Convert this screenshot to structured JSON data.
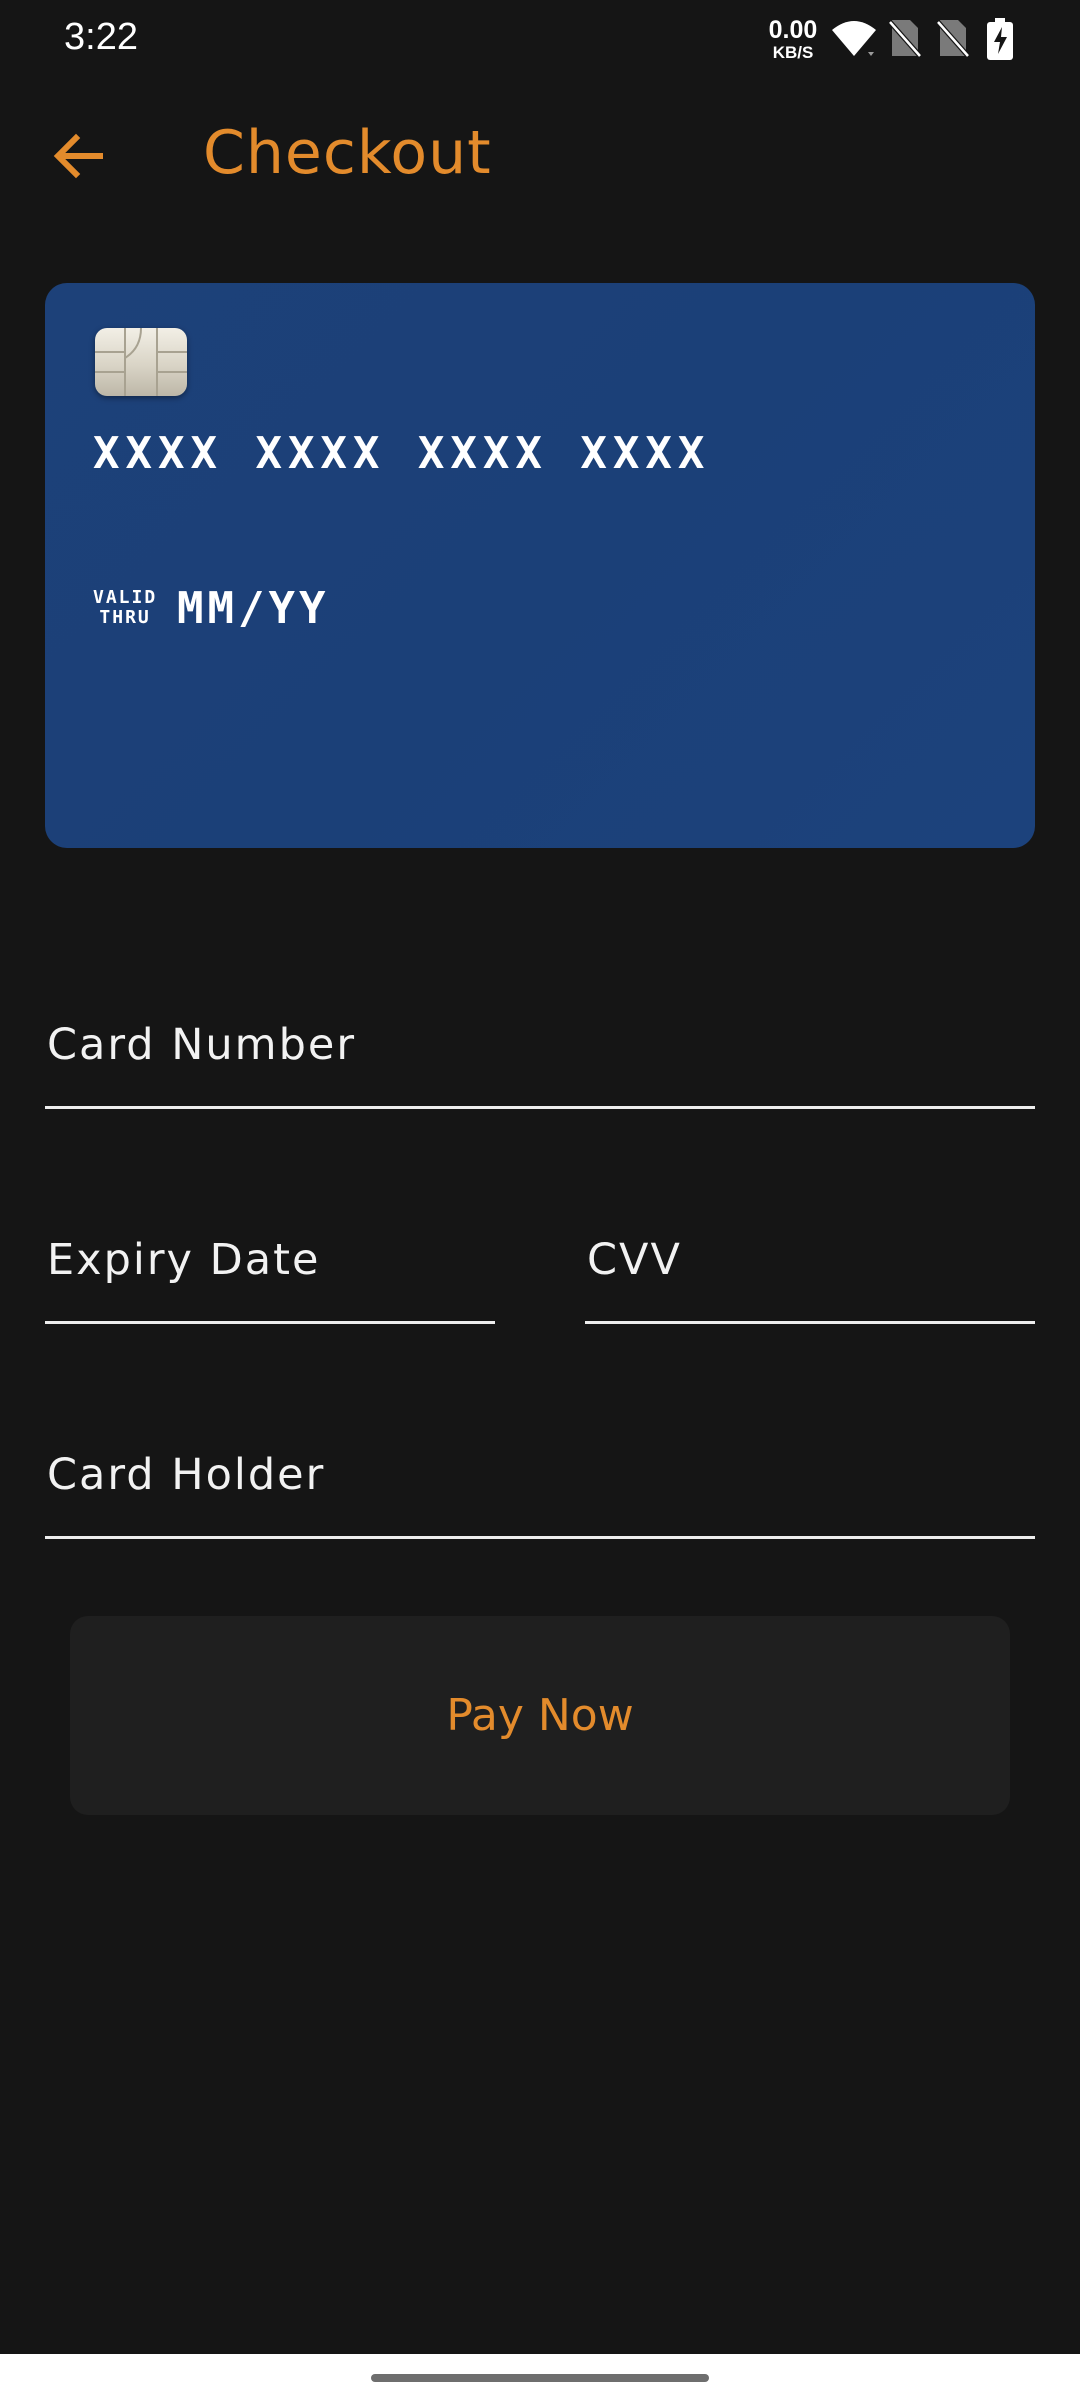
{
  "status_bar": {
    "time": "3:22",
    "net_speed_value": "0.00",
    "net_speed_unit": "KB/S",
    "icons": [
      "wifi-icon",
      "sim-off-icon",
      "sim-off-icon",
      "battery-charging-icon"
    ]
  },
  "header": {
    "title": "Checkout",
    "back_icon": "arrow-left-icon"
  },
  "card": {
    "number": "XXXX XXXX XXXX XXXX",
    "valid_line1": "VALID",
    "valid_line2": "THRU",
    "expiry": "MM/YY",
    "chip_icon": "card-chip-icon"
  },
  "form": {
    "card_number_label": "Card Number",
    "expiry_label": "Expiry Date",
    "cvv_label": "CVV",
    "card_holder_label": "Card Holder"
  },
  "actions": {
    "pay_label": "Pay Now"
  },
  "colors": {
    "background": "#151515",
    "accent": "#E38B2C",
    "card": "#1C4179",
    "button": "#1F1F1F"
  }
}
